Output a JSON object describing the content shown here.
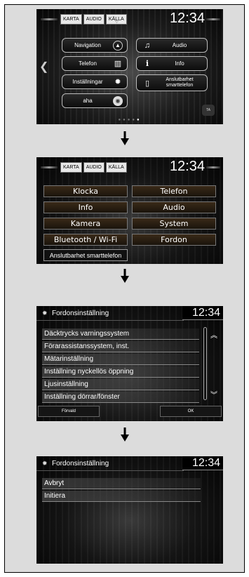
{
  "screen1": {
    "tabs": [
      "KARTA",
      "AUDIO",
      "KÄLLA"
    ],
    "clock": "12:34",
    "left_buttons": [
      {
        "label": "Navigation",
        "icon": "compass-icon",
        "glyph": "◭"
      },
      {
        "label": "Telefon",
        "icon": "phone-icon",
        "glyph": "▯"
      },
      {
        "label": "Inställningar",
        "icon": "gear-icon",
        "glyph": "✹"
      },
      {
        "label": "aha",
        "icon": "aha-icon",
        "glyph": "◉"
      }
    ],
    "right_buttons": [
      {
        "label": "Audio",
        "icon": "music-note-icon",
        "glyph": "♫"
      },
      {
        "label": "Info",
        "icon": "info-icon",
        "glyph": "i"
      },
      {
        "label": "Anslutbarhet smarttelefon",
        "icon": "smartphone-icon",
        "glyph": "▯"
      }
    ],
    "ta_label": "TA",
    "page_dots": 5,
    "active_dot": 5
  },
  "screen2": {
    "tabs": [
      "KARTA",
      "AUDIO",
      "KÄLLA"
    ],
    "clock": "12:34",
    "buttons": [
      [
        "Klocka",
        "Telefon"
      ],
      [
        "Info",
        "Audio"
      ],
      [
        "Kamera",
        "System"
      ],
      [
        "Bluetooth / Wi-Fi",
        "Fordon"
      ]
    ],
    "wide_button": "Anslutbarhet smarttelefon"
  },
  "screen3": {
    "title": "Fordonsinställning",
    "clock": "12:34",
    "items": [
      "Däcktrycks varningssystem",
      "Förarassistanssystem, inst.",
      "Mätarinställning",
      "Inställning nyckellös öppning",
      "Ljusinställning",
      "Inställning dörrar/fönster"
    ],
    "default_button": "Förvald",
    "ok_button": "OK"
  },
  "screen4": {
    "title": "Fordonsinställning",
    "clock": "12:34",
    "items": [
      "Avbryt",
      "Initiera"
    ]
  }
}
